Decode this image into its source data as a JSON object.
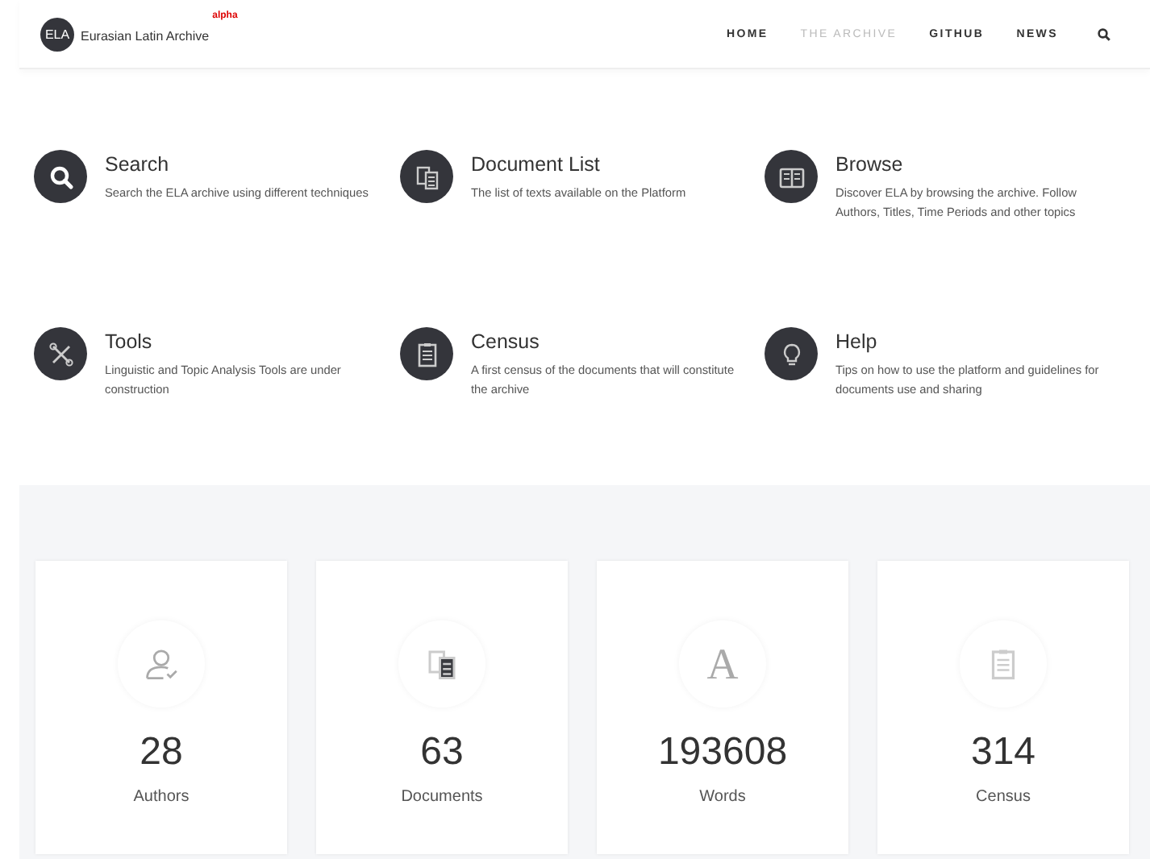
{
  "header": {
    "logo": "ELA",
    "title": "Eurasian Latin Archive",
    "badge": "alpha",
    "nav": [
      {
        "label": "HOME",
        "selected": false
      },
      {
        "label": "THE ARCHIVE",
        "selected": true
      },
      {
        "label": "GITHUB",
        "selected": false
      },
      {
        "label": "NEWS",
        "selected": false
      }
    ]
  },
  "features": [
    {
      "kind": "search",
      "title": "Search",
      "text": "Search the ELA archive using different techniques"
    },
    {
      "kind": "documents",
      "title": "Document List",
      "text": "The list of texts available on the Platform"
    },
    {
      "kind": "book",
      "title": "Browse",
      "text": "Discover ELA by browsing the archive. Follow Authors, Titles, Time Periods and other topics"
    },
    {
      "kind": "tools",
      "title": "Tools",
      "text": "Linguistic and Topic Analysis Tools are under construction"
    },
    {
      "kind": "clipboard",
      "title": "Census",
      "text": "A first census of the documents that will constitute the archive"
    },
    {
      "kind": "bulb",
      "title": "Help",
      "text": "Tips on how to use the platform and guidelines for documents use and sharing"
    }
  ],
  "stats": [
    {
      "kind": "user",
      "value": "28",
      "label": "Authors"
    },
    {
      "kind": "documents",
      "value": "63",
      "label": "Documents"
    },
    {
      "kind": "letter",
      "glyph": "A",
      "value": "193608",
      "label": "Words"
    },
    {
      "kind": "clipboard",
      "value": "314",
      "label": "Census"
    }
  ]
}
